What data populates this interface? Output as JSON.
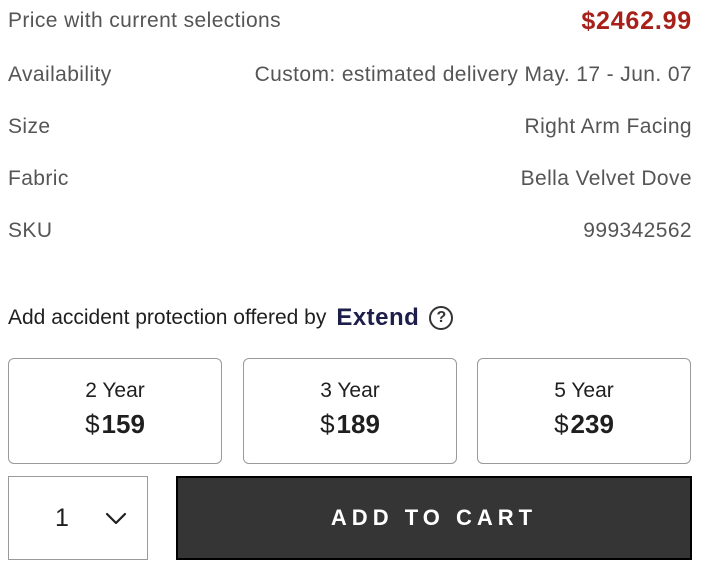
{
  "summary": {
    "price": {
      "label": "Price with current selections",
      "value": "$2462.99"
    },
    "availability": {
      "label": "Availability",
      "value": "Custom: estimated delivery May. 17 - Jun. 07"
    },
    "size": {
      "label": "Size",
      "value": "Right Arm Facing"
    },
    "fabric": {
      "label": "Fabric",
      "value": "Bella Velvet Dove"
    },
    "sku": {
      "label": "SKU",
      "value": "999342562"
    }
  },
  "protection": {
    "text": "Add accident protection offered by",
    "brand": "Extend",
    "help_icon": "question-circle-icon",
    "help_glyph": "?"
  },
  "plans": [
    {
      "term": "2 Year",
      "currency": "$",
      "amount": "159"
    },
    {
      "term": "3 Year",
      "currency": "$",
      "amount": "189"
    },
    {
      "term": "5 Year",
      "currency": "$",
      "amount": "239"
    }
  ],
  "quantity": {
    "value": "1",
    "icon": "chevron-down-icon"
  },
  "cart": {
    "label": "ADD TO CART"
  },
  "colors": {
    "price": "#a8201a",
    "button_bg": "#353535",
    "brand": "#1e1e4a"
  }
}
